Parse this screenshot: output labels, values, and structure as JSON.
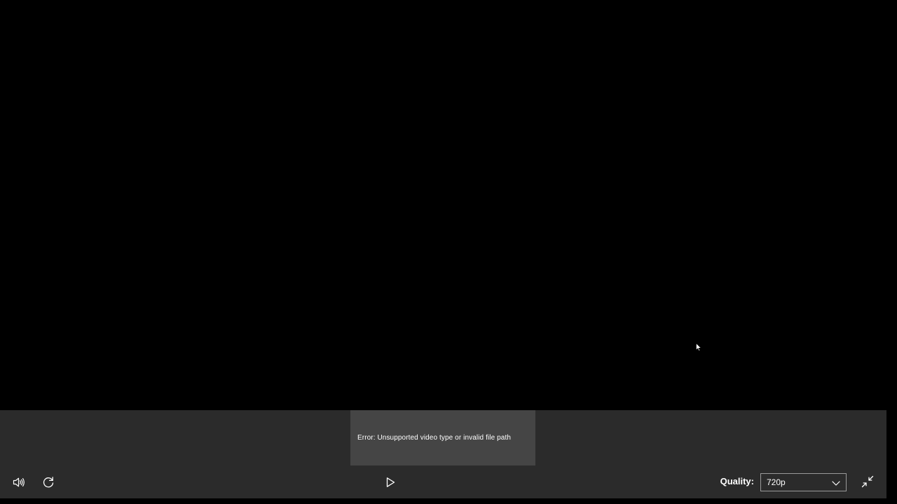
{
  "player": {
    "error_message": "Error: Unsupported video type or invalid file path",
    "quality_label": "Quality:",
    "quality_value": "720p",
    "quality_options": [
      "720p"
    ]
  },
  "icons": {
    "volume": "volume-icon",
    "replay": "replay-icon",
    "play": "play-icon",
    "quality_dropdown": "chevron-down-icon",
    "fullscreen": "exit-fullscreen-icon",
    "cursor": "mouse-pointer-icon"
  },
  "colors": {
    "video_background": "#000000",
    "control_bar": "#2b2b2b",
    "error_toast": "#454545",
    "text": "#ffffff",
    "select_border": "#9a9a9a"
  }
}
